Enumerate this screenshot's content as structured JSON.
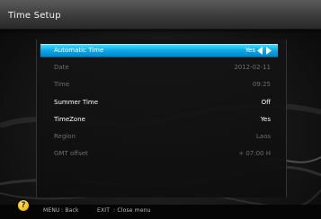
{
  "window": {
    "title": "Time Setup"
  },
  "settings": [
    {
      "label": "Automatic Time",
      "value": "Yes",
      "state": "selected",
      "name": "automatic-time"
    },
    {
      "label": "Date",
      "value": "2012-02-11",
      "state": "disabled",
      "name": "date"
    },
    {
      "label": "Time",
      "value": "09:25",
      "state": "disabled",
      "name": "time"
    },
    {
      "label": "Summer Time",
      "value": "Off",
      "state": "enabled",
      "name": "summer-time"
    },
    {
      "label": "TimeZone",
      "value": "Yes",
      "state": "enabled",
      "name": "timezone"
    },
    {
      "label": "Region",
      "value": "Laos",
      "state": "disabled",
      "name": "region"
    },
    {
      "label": "GMT offset",
      "value": "+ 07:00 H",
      "state": "disabled",
      "name": "gmt-offset"
    }
  ],
  "footer": {
    "help_icon": "question-icon",
    "menu_key": "MENU",
    "menu_action": ": Back",
    "exit_key": "EXIT",
    "exit_action": ": Close menu"
  },
  "colors": {
    "highlight": "#0aa8e6",
    "enabled_text": "#ffffff",
    "disabled_text": "#6e6e6e",
    "help_icon": "#f6c20e"
  }
}
